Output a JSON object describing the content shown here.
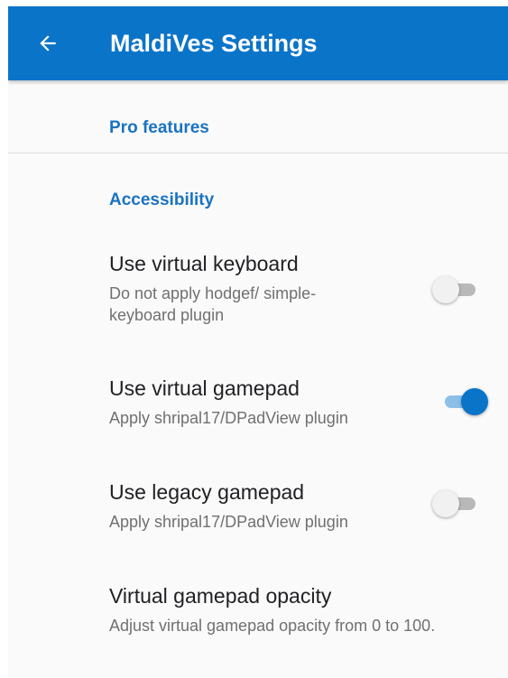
{
  "app_bar": {
    "title": "MaldiVes Settings",
    "back_icon": "arrow-back-icon",
    "background": "#0a74c9"
  },
  "categories": {
    "pro_features": "Pro features",
    "accessibility": "Accessibility"
  },
  "preferences": [
    {
      "title": "Use virtual keyboard",
      "summary": "Do not apply hodgef/ simple-keyboard plugin",
      "switch_on": false
    },
    {
      "title": "Use virtual gamepad",
      "summary": "Apply shripal17/DPadView plugin",
      "switch_on": true
    },
    {
      "title": "Use legacy gamepad",
      "summary": "Apply shripal17/DPadView plugin",
      "switch_on": false
    },
    {
      "title": "Virtual gamepad opacity",
      "summary": "Adjust virtual gamepad opacity from 0 to 100."
    }
  ],
  "colors": {
    "accent": "#1a73c1",
    "switch_on_thumb": "#0a74c9",
    "switch_on_track": "#8cbfe8",
    "switch_off_track": "#b9b9b9"
  }
}
